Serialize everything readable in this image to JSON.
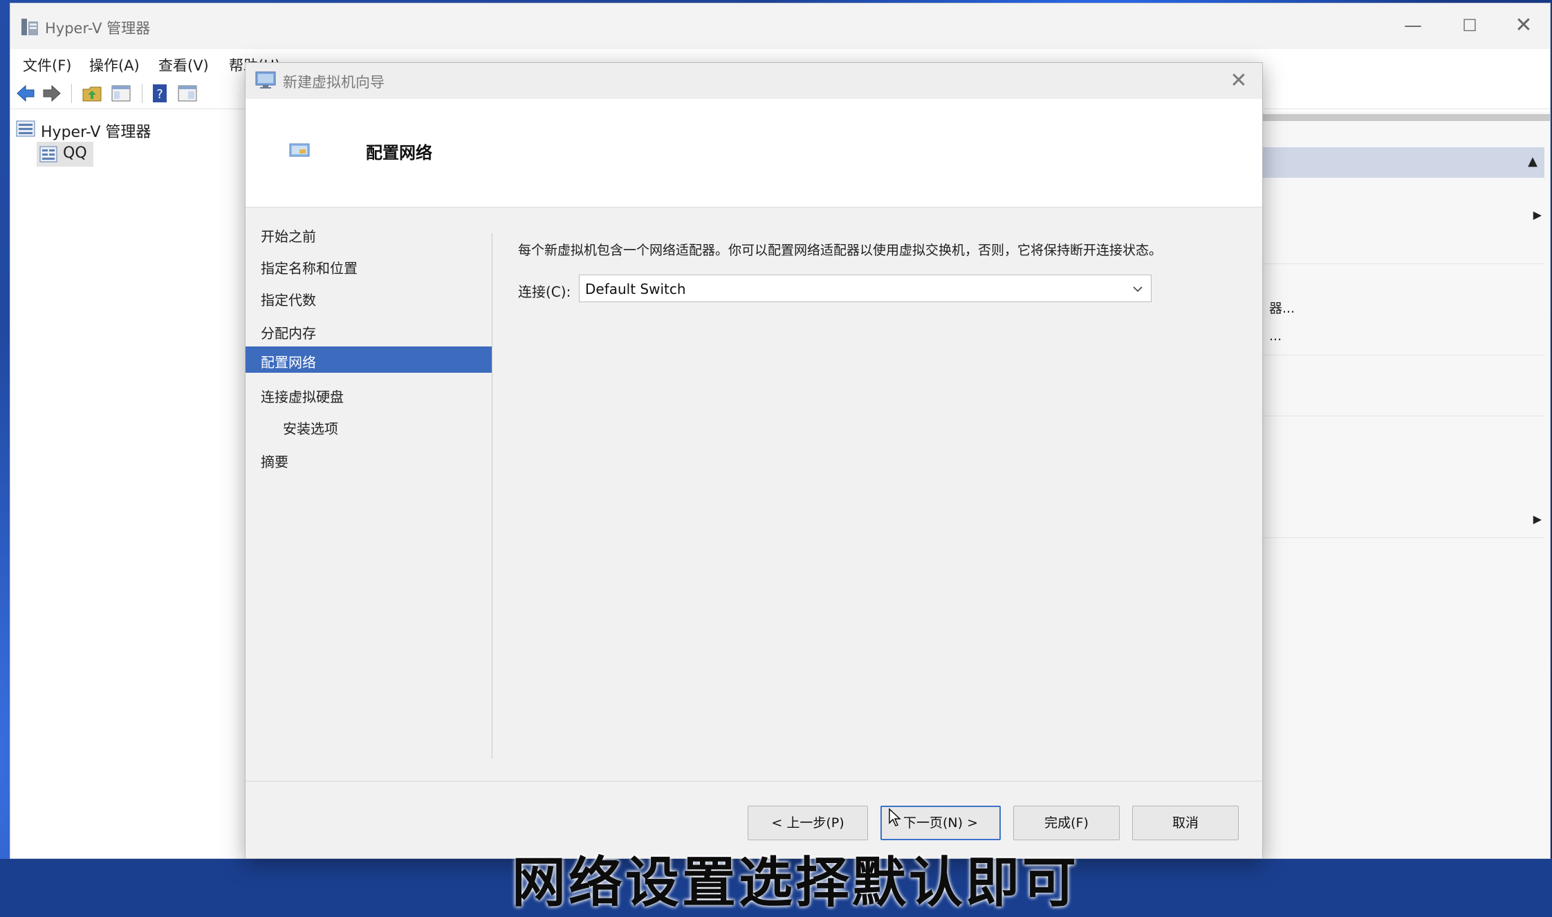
{
  "main_window": {
    "title": "Hyper-V 管理器",
    "controls": {
      "minimize": "—",
      "maximize": "☐",
      "close": "✕"
    },
    "menu": [
      "文件(F)",
      "操作(A)",
      "查看(V)",
      "帮助(H)"
    ]
  },
  "tree": {
    "root": "Hyper-V 管理器",
    "host": "QQ"
  },
  "actions_panel": {
    "partial_items": [
      "器...",
      "..."
    ]
  },
  "dialog": {
    "title": "新建虚拟机向导",
    "close": "✕",
    "header_title": "配置网络",
    "steps": [
      "开始之前",
      "指定名称和位置",
      "指定代数",
      "分配内存",
      "配置网络",
      "连接虚拟硬盘",
      "安装选项",
      "摘要"
    ],
    "active_step": "配置网络",
    "description": "每个新虚拟机包含一个网络适配器。你可以配置网络适配器以使用虚拟交换机，否则，它将保持断开连接状态。",
    "connection_label": "连接(C):",
    "connection_value": "Default Switch",
    "buttons": {
      "previous": "< 上一步(P)",
      "next": "下一页(N) >",
      "finish": "完成(F)",
      "cancel": "取消"
    }
  },
  "subtitle": "网络设置选择默认即可",
  "colors": {
    "selection": "#3d6bbd",
    "primary_border": "#3a73c9",
    "wallpaper": "#1b3f8f"
  }
}
